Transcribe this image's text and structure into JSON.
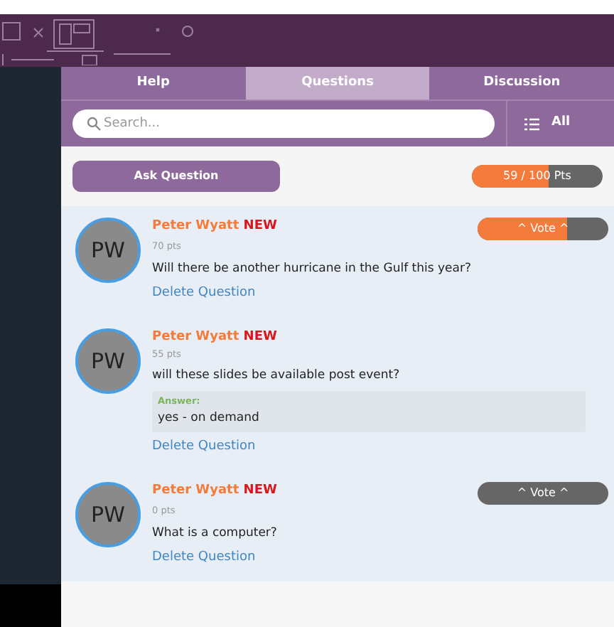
{
  "tabs": [
    {
      "label": "Help",
      "selected": false
    },
    {
      "label": "Questions",
      "selected": true
    },
    {
      "label": "Discussion",
      "selected": false
    }
  ],
  "search": {
    "placeholder": "Search..."
  },
  "filter": {
    "label": "All"
  },
  "ask_button": "Ask Question",
  "points": {
    "reading": "59 / 100 Pts",
    "level": 0.59
  },
  "questions": [
    {
      "initials": "PW",
      "author": "Peter Wyatt",
      "badge": "NEW",
      "points": "70 pts",
      "text": "Will there be another hurricane in the Gulf this year?",
      "vote": {
        "label": "^ Vote ^",
        "level": 0.69
      },
      "delete": "Delete Question"
    },
    {
      "initials": "PW",
      "author": "Peter Wyatt",
      "badge": "NEW",
      "points": "55 pts",
      "text": "will these slides be available post event?",
      "answer": {
        "label": "Answer:",
        "text": "yes - on demand"
      },
      "delete": "Delete Question"
    },
    {
      "initials": "PW",
      "author": "Peter Wyatt",
      "badge": "NEW",
      "points": "0 pts",
      "text": "What is a computer?",
      "vote": {
        "label": "^ Vote ^",
        "level": 0
      },
      "delete": "Delete Question"
    }
  ]
}
